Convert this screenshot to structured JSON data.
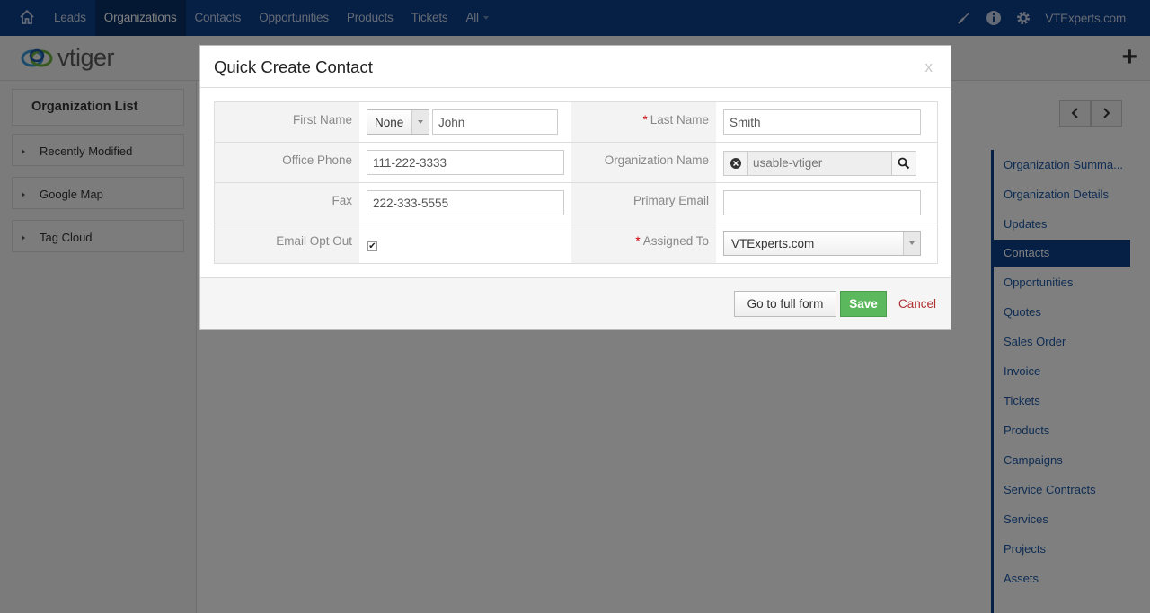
{
  "topnav": {
    "menu": [
      {
        "label": "Leads",
        "active": false
      },
      {
        "label": "Organizations",
        "active": true
      },
      {
        "label": "Contacts",
        "active": false
      },
      {
        "label": "Opportunities",
        "active": false
      },
      {
        "label": "Products",
        "active": false
      },
      {
        "label": "Tickets",
        "active": false
      },
      {
        "label": "All",
        "active": false
      }
    ],
    "user": "VTExperts.com",
    "icons": [
      "home-icon",
      "brush-icon",
      "info-icon",
      "gear-icon"
    ]
  },
  "header": {
    "logo_text": "vtiger",
    "add_icon": "plus-icon"
  },
  "sidebar": {
    "title": "Organization List",
    "sections": [
      "Recently Modified",
      "Google Map",
      "Tag Cloud"
    ]
  },
  "related": {
    "items": [
      {
        "label": "Organization Summa...",
        "active": false
      },
      {
        "label": "Organization Details",
        "active": false
      },
      {
        "label": "Updates",
        "active": false
      },
      {
        "label": "Contacts",
        "active": true
      },
      {
        "label": "Opportunities",
        "active": false
      },
      {
        "label": "Quotes",
        "active": false
      },
      {
        "label": "Sales Order",
        "active": false
      },
      {
        "label": "Invoice",
        "active": false
      },
      {
        "label": "Tickets",
        "active": false
      },
      {
        "label": "Products",
        "active": false
      },
      {
        "label": "Campaigns",
        "active": false
      },
      {
        "label": "Service Contracts",
        "active": false
      },
      {
        "label": "Services",
        "active": false
      },
      {
        "label": "Projects",
        "active": false
      },
      {
        "label": "Assets",
        "active": false
      }
    ]
  },
  "modal": {
    "title": "Quick Create Contact",
    "close_label": "x",
    "fields": {
      "first_name_label": "First Name",
      "salutation": "None",
      "first_name": "John",
      "last_name_label": "Last Name",
      "last_name": "Smith",
      "office_phone_label": "Office Phone",
      "office_phone": "111-222-3333",
      "org_name_label": "Organization Name",
      "org_name": "usable-vtiger",
      "fax_label": "Fax",
      "fax": "222-333-5555",
      "primary_email_label": "Primary Email",
      "primary_email": "",
      "email_opt_out_label": "Email Opt Out",
      "email_opt_out": true,
      "assigned_to_label": "Assigned To",
      "assigned_to": "VTExperts.com",
      "required_marker": "*"
    },
    "buttons": {
      "full_form": "Go to full form",
      "save": "Save",
      "cancel": "Cancel"
    }
  },
  "colors": {
    "nav": "#0b3e8a",
    "save": "#5cb85c",
    "cancel": "#b03030",
    "link": "#1e5aa8"
  }
}
